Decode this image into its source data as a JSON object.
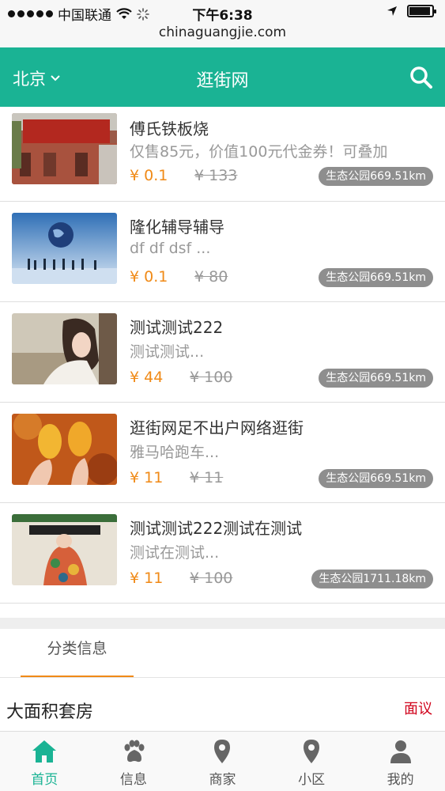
{
  "status_bar": {
    "carrier": "中国联通",
    "time": "下午6:38"
  },
  "url": "chinaguangjie.com",
  "header": {
    "city": "北京",
    "title": "逛街网"
  },
  "colors": {
    "brand": "#1ab394",
    "price": "#f08a17",
    "negotiable": "#d0021b"
  },
  "items": [
    {
      "title": "傅氏铁板烧",
      "desc": "仅售85元，价值100元代金券！可叠加",
      "price": "¥ 0.1",
      "old_price": "¥ 133",
      "distance": "生态公园669.51km"
    },
    {
      "title": "隆化辅导辅导",
      "desc": "df df dsf ...",
      "price": "¥ 0.1",
      "old_price": "¥ 80",
      "distance": "生态公园669.51km"
    },
    {
      "title": "测试测试222",
      "desc": "测试测试...",
      "price": "¥ 44",
      "old_price": "¥ 100",
      "distance": "生态公园669.51km"
    },
    {
      "title": "逛街网足不出户网络逛街",
      "desc": "雅马哈跑车...",
      "price": "¥ 11",
      "old_price": "¥ 11",
      "distance": "生态公园669.51km"
    },
    {
      "title": "测试测试222测试在测试",
      "desc": "测试在测试...",
      "price": "¥ 11",
      "old_price": "¥ 100",
      "distance": "生态公园1711.18km"
    }
  ],
  "section_tab": "分类信息",
  "info": {
    "title": "大面积套房",
    "price": "面议"
  },
  "nav": [
    {
      "label": "首页",
      "icon": "home-icon",
      "active": true
    },
    {
      "label": "信息",
      "icon": "paw-icon",
      "active": false
    },
    {
      "label": "商家",
      "icon": "map-pin-icon",
      "active": false
    },
    {
      "label": "小区",
      "icon": "map-pin-icon",
      "active": false
    },
    {
      "label": "我的",
      "icon": "user-icon",
      "active": false
    }
  ]
}
